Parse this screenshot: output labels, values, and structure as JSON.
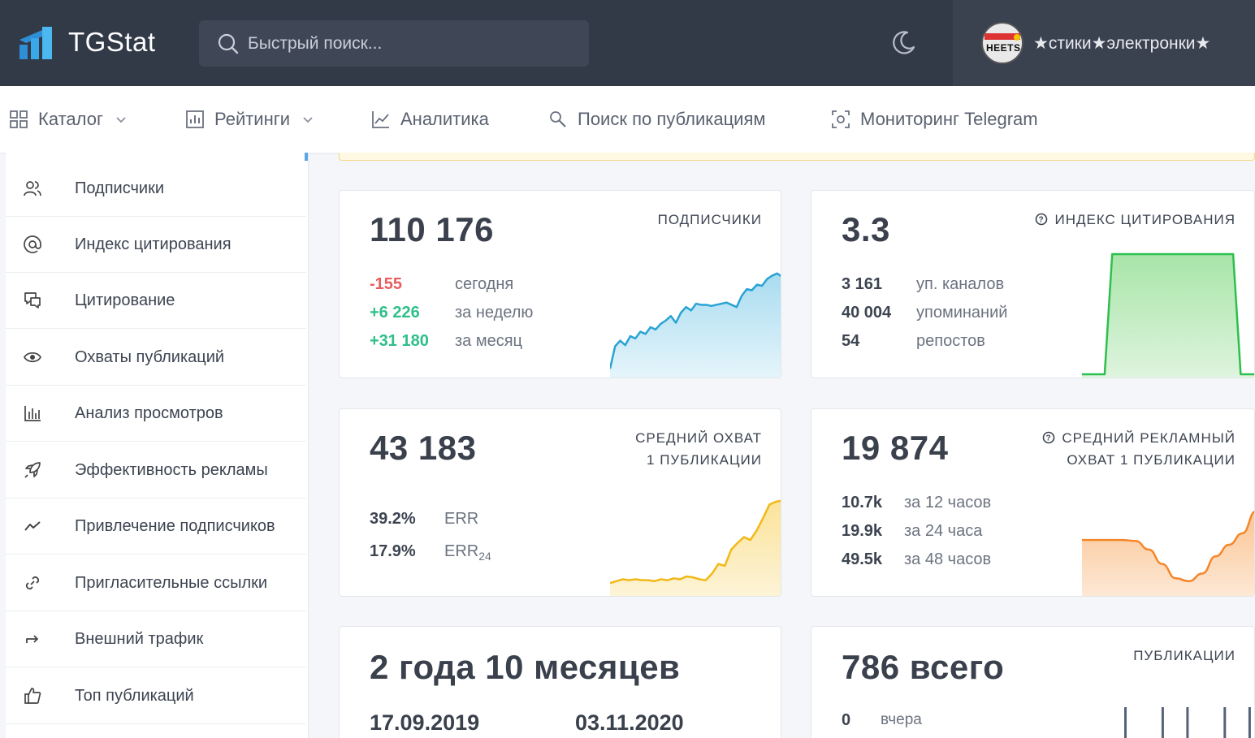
{
  "header": {
    "brand": "TGStat",
    "search_placeholder": "Быстрый поиск...",
    "account_name": "★стики★электронки★",
    "avatar_text": "HEETS"
  },
  "nav": [
    {
      "label": "Каталог",
      "icon": "grid-icon",
      "dropdown": true
    },
    {
      "label": "Рейтинги",
      "icon": "bar-chart-icon",
      "dropdown": true
    },
    {
      "label": "Аналитика",
      "icon": "line-chart-icon",
      "dropdown": false
    },
    {
      "label": "Поиск по публикациям",
      "icon": "search-icon",
      "dropdown": false
    },
    {
      "label": "Мониторинг Telegram",
      "icon": "monitoring-icon",
      "dropdown": false
    }
  ],
  "sidebar": {
    "items": [
      {
        "label": "Подписчики",
        "icon": "users-icon"
      },
      {
        "label": "Индекс цитирования",
        "icon": "at-icon"
      },
      {
        "label": "Цитирование",
        "icon": "quote-icon"
      },
      {
        "label": "Охваты публикаций",
        "icon": "eye-icon"
      },
      {
        "label": "Анализ просмотров",
        "icon": "bars-icon"
      },
      {
        "label": "Эффективность рекламы",
        "icon": "rocket-icon"
      },
      {
        "label": "Привлечение подписчиков",
        "icon": "trend-icon"
      },
      {
        "label": "Пригласительные ссылки",
        "icon": "link-icon"
      },
      {
        "label": "Внешний трафик",
        "icon": "redirect-icon"
      },
      {
        "label": "Топ публикаций",
        "icon": "thumbs-up-icon"
      }
    ]
  },
  "cards": {
    "subscribers": {
      "value": "110 176",
      "title": "ПОДПИСЧИКИ",
      "rows": [
        {
          "value": "-155",
          "label": "сегодня",
          "color": "#e85d5d"
        },
        {
          "value": "+6 226",
          "label": "за неделю",
          "color": "#2fbf8a"
        },
        {
          "value": "+31 180",
          "label": "за месяц",
          "color": "#2fbf8a"
        }
      ],
      "spark": [
        0.05,
        0.25,
        0.3,
        0.26,
        0.34,
        0.32,
        0.38,
        0.36,
        0.42,
        0.4,
        0.45,
        0.48,
        0.52,
        0.46,
        0.55,
        0.6,
        0.57,
        0.63,
        0.62,
        0.62,
        0.61,
        0.62,
        0.63,
        0.64,
        0.62,
        0.6,
        0.7,
        0.76,
        0.75,
        0.8,
        0.79,
        0.85,
        0.88,
        0.9,
        0.87
      ]
    },
    "citation": {
      "value": "3.3",
      "title": "ИНДЕКС ЦИТИРОВАНИЯ",
      "rows": [
        {
          "value": "3 161",
          "label": "уп. каналов"
        },
        {
          "value": "40 004",
          "label": "упоминаний"
        },
        {
          "value": "54",
          "label": "репостов"
        }
      ],
      "spark": [
        0,
        0,
        0,
        0,
        1,
        1,
        1,
        1,
        1,
        1,
        1,
        1,
        1,
        1,
        1,
        1,
        1,
        1,
        1,
        1,
        1,
        0,
        0,
        0
      ]
    },
    "reach": {
      "value": "43 183",
      "title_line1": "СРЕДНИЙ ОХВАТ",
      "title_line2": "1 ПУБЛИКАЦИИ",
      "rows": [
        {
          "value": "39.2%",
          "label": "ERR",
          "sub": ""
        },
        {
          "value": "17.9%",
          "label": "ERR",
          "sub": "24"
        }
      ],
      "spark": [
        0.1,
        0.12,
        0.14,
        0.13,
        0.14,
        0.13,
        0.13,
        0.12,
        0.14,
        0.13,
        0.15,
        0.14,
        0.17,
        0.16,
        0.14,
        0.13,
        0.2,
        0.3,
        0.28,
        0.45,
        0.52,
        0.58,
        0.55,
        0.65,
        0.78,
        0.92,
        0.95,
        0.96
      ]
    },
    "ad_reach": {
      "value": "19 874",
      "title_line1": "СРЕДНИЙ РЕКЛАМНЫЙ",
      "title_line2": "ОХВАТ 1 ПУБЛИКАЦИИ",
      "rows": [
        {
          "value": "10.7k",
          "label": "за 12 часов"
        },
        {
          "value": "19.9k",
          "label": "за 24 часа"
        },
        {
          "value": "49.5k",
          "label": "за 48 часов"
        }
      ],
      "spark": [
        0.55,
        0.55,
        0.55,
        0.55,
        0.54,
        0.45,
        0.3,
        0.15,
        0.12,
        0.2,
        0.38,
        0.5,
        0.62,
        0.85
      ]
    },
    "age": {
      "value": "2 года 10 месяцев",
      "date_start": "17.09.2019",
      "date_end": "03.11.2020"
    },
    "posts": {
      "value": "786 всего",
      "title": "ПУБЛИКАЦИИ",
      "rows": [
        {
          "value": "0",
          "label": "вчера"
        }
      ],
      "bars": [
        0,
        0,
        0,
        1,
        0,
        0,
        1,
        0,
        1,
        0,
        0,
        1,
        0,
        1
      ]
    }
  },
  "colors": {
    "topbar": "#323a48",
    "blue": "#2aa3d3",
    "green": "#2dbf4d",
    "yellow": "#f2b817",
    "orange": "#f5862a"
  }
}
